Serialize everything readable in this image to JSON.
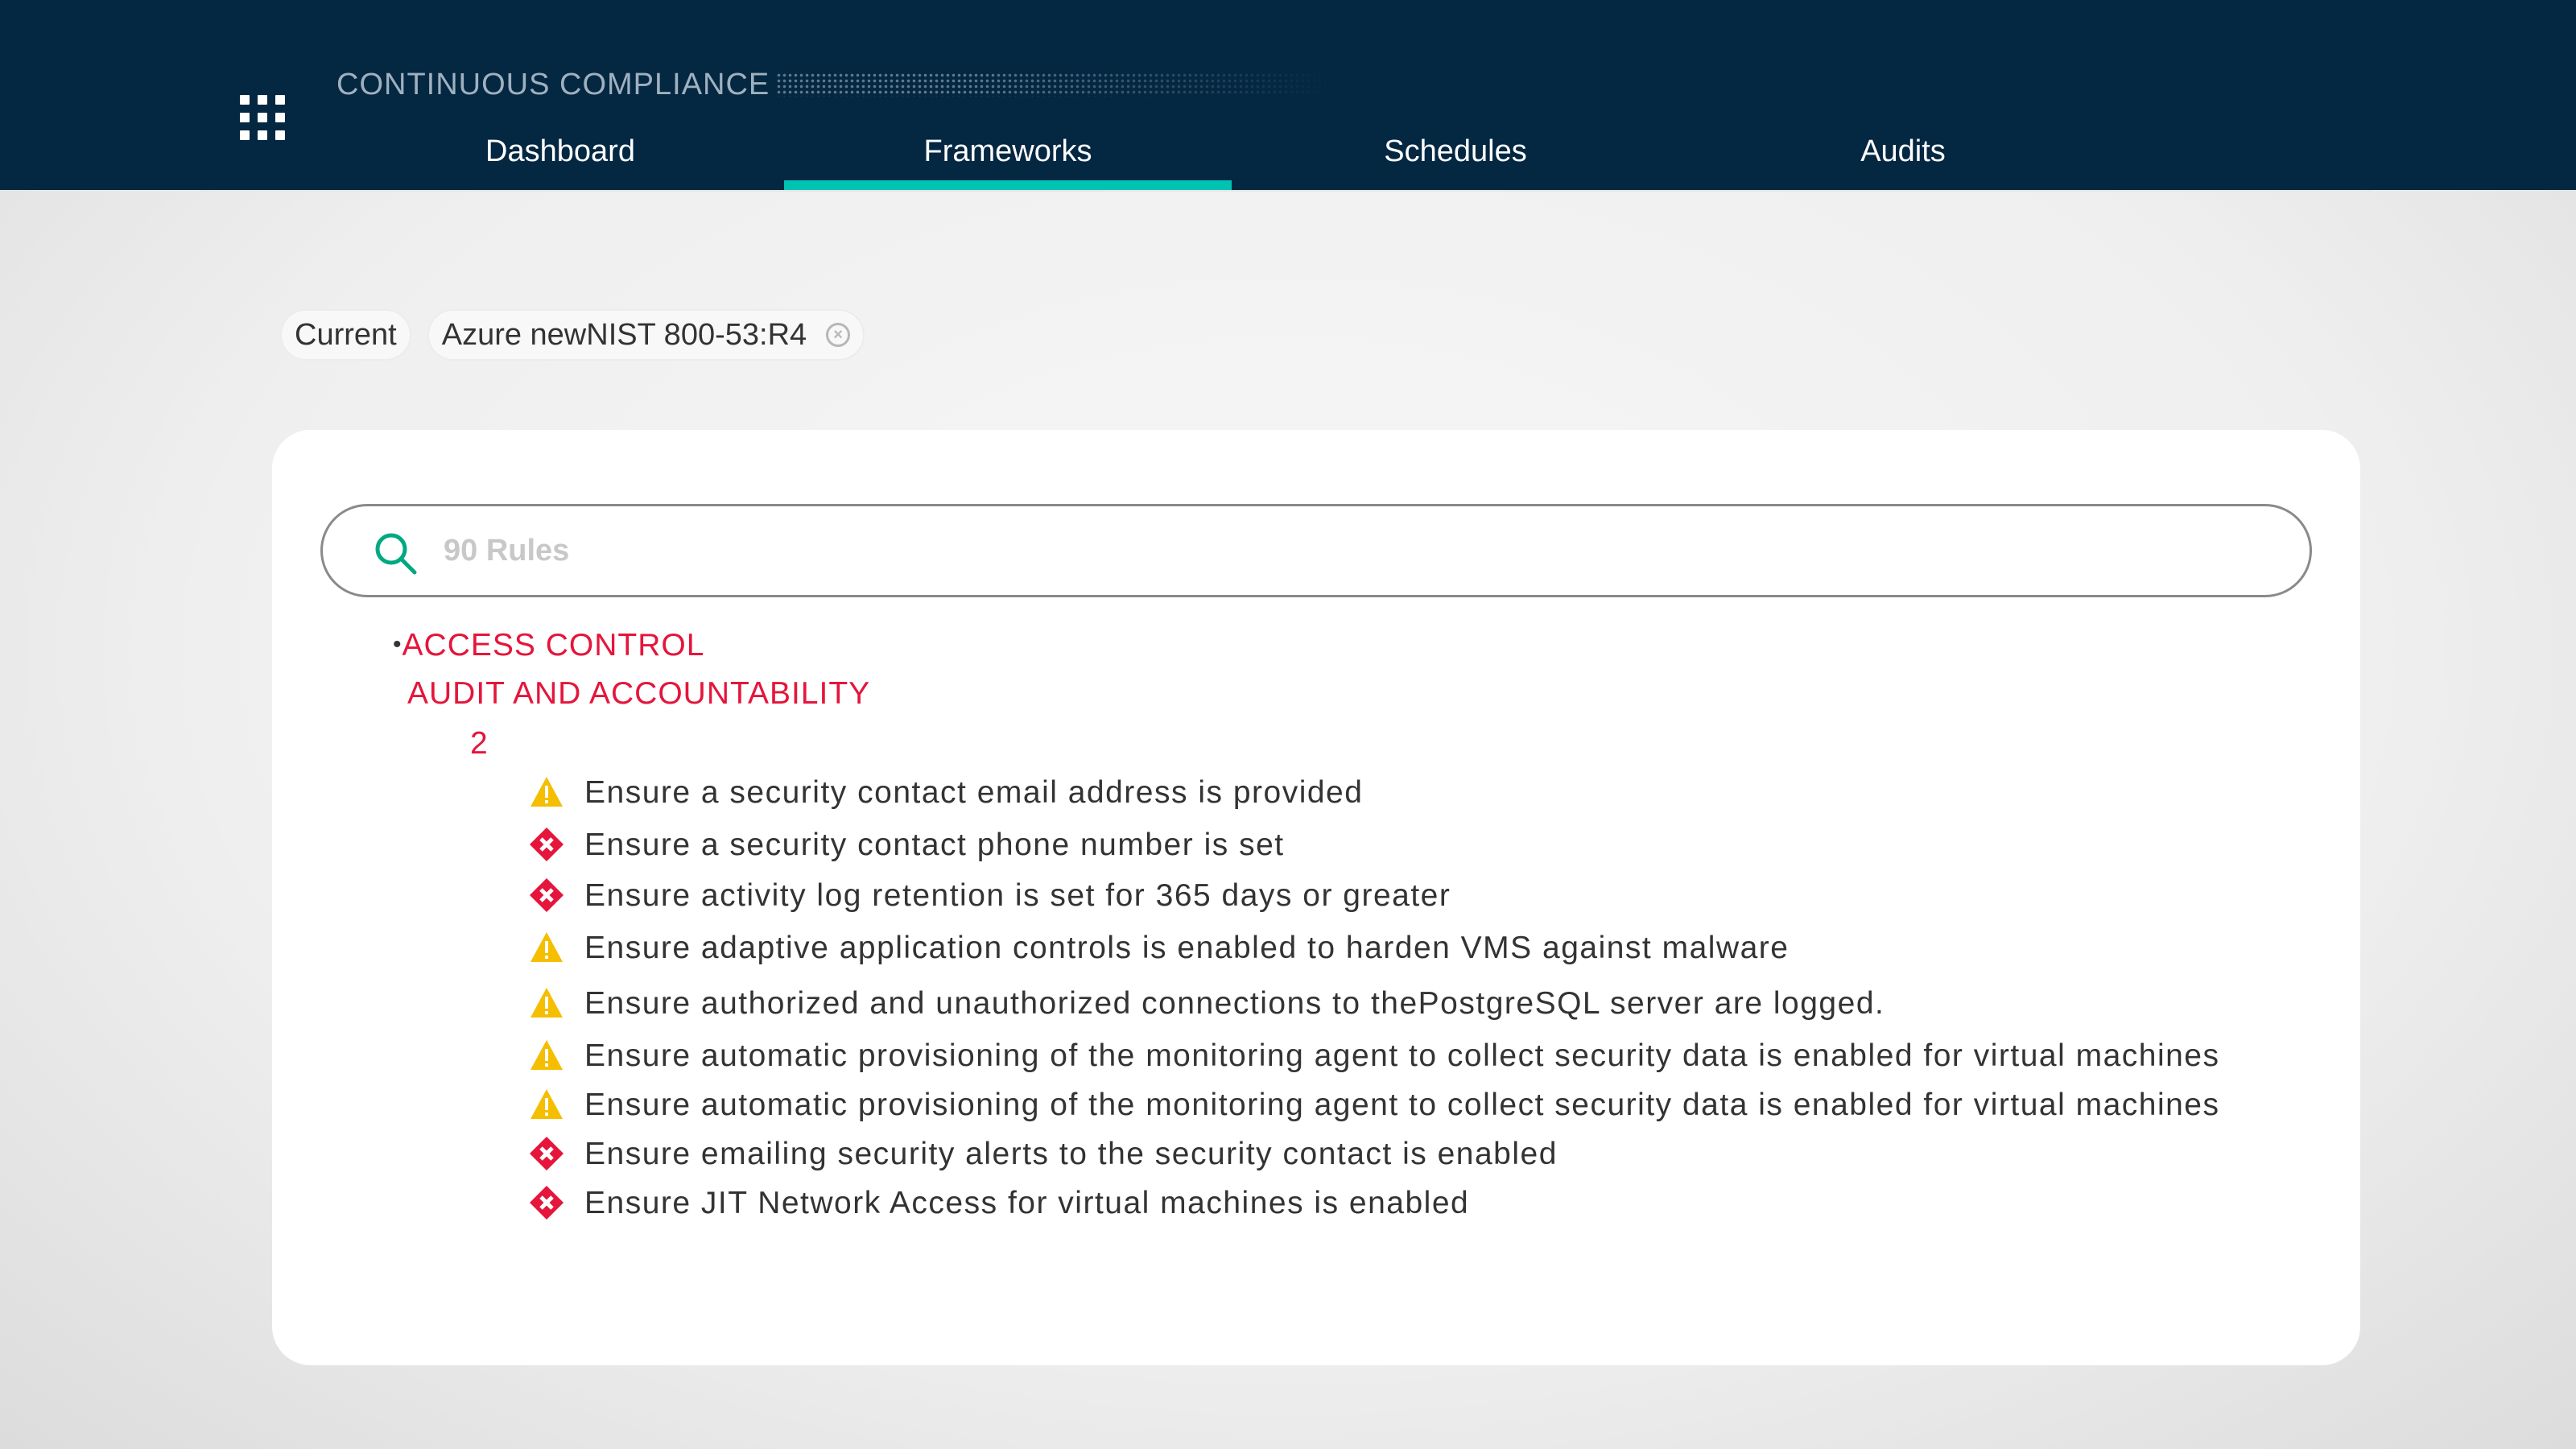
{
  "header": {
    "app_title": "CONTINUOUS COMPLIANCE",
    "tabs": [
      {
        "label": "Dashboard",
        "active": false
      },
      {
        "label": "Frameworks",
        "active": true
      },
      {
        "label": "Schedules",
        "active": false
      },
      {
        "label": "Audits",
        "active": false
      }
    ],
    "accent_color": "#01c3b4",
    "background_color": "#042742"
  },
  "breadcrumb": {
    "current_label": "Current",
    "framework_label": "Azure newNIST 800-53:R4"
  },
  "search": {
    "placeholder": "90 Rules",
    "value": ""
  },
  "tree": {
    "category_1": "ACCESS CONTROL",
    "category_2": "AUDIT AND ACCOUNTABILITY",
    "sub_category": "2",
    "category_color": "#e5153b",
    "rules": [
      {
        "status": "warning",
        "icon": "warning-icon",
        "text": "Ensure a security contact email address is provided"
      },
      {
        "status": "failed",
        "icon": "failed-icon",
        "text": "Ensure a security contact phone number is set"
      },
      {
        "status": "failed",
        "icon": "failed-icon",
        "text": "Ensure activity log retention is set for 365 days or greater"
      },
      {
        "status": "warning",
        "icon": "warning-icon",
        "text": "Ensure adaptive application controls is enabled to harden VMS against malware"
      },
      {
        "status": "warning",
        "icon": "warning-icon",
        "text": "Ensure authorized and unauthorized connections to thePostgreSQL server are logged."
      },
      {
        "status": "warning",
        "icon": "warning-icon",
        "text": "Ensure automatic provisioning of the monitoring agent to collect security data is enabled for virtual machines"
      },
      {
        "status": "warning",
        "icon": "warning-icon",
        "text": "Ensure automatic provisioning of the monitoring agent to collect security data is enabled for virtual machines"
      },
      {
        "status": "failed",
        "icon": "failed-icon",
        "text": "Ensure emailing security alerts to the security contact is enabled"
      },
      {
        "status": "failed",
        "icon": "failed-icon",
        "text": "Ensure JIT Network Access for virtual machines is enabled"
      }
    ],
    "warning_color": "#f5be00",
    "failed_color": "#e5153b"
  }
}
